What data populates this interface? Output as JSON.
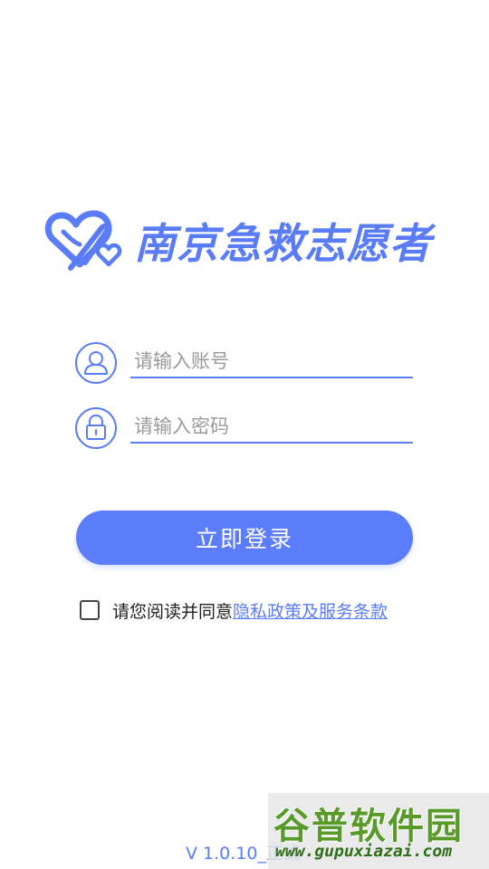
{
  "app": {
    "name": "南京急救志愿者",
    "accent_color": "#5b7cfb"
  },
  "login_form": {
    "account_placeholder": "请输入账号",
    "account_value": "",
    "account_icon": "user-icon",
    "password_placeholder": "请输入密码",
    "password_value": "",
    "password_icon": "lock-icon",
    "login_button_label": "立即登录"
  },
  "agreement": {
    "checked": false,
    "text": "请您阅读并同意",
    "link_text": "隐私政策及服务条款"
  },
  "footer": {
    "version": "V 1.0.10_正式"
  },
  "watermark": {
    "title": "谷普软件园",
    "url": "www.gupuxiazai.com"
  }
}
